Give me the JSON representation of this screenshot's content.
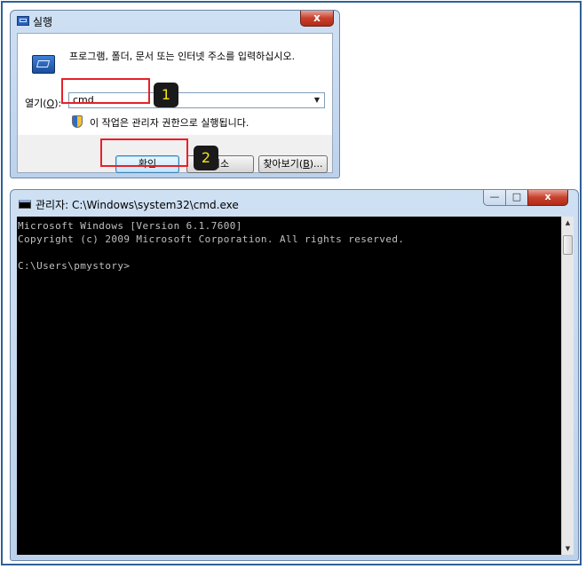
{
  "run_dialog": {
    "title": "실행",
    "close_glyph": "x",
    "description": "프로그램, 폴더, 문서 또는 인터넷 주소를 입력하십시오.",
    "open_label_prefix": "열기(",
    "open_label_key": "O",
    "open_label_suffix": "):",
    "open_value": "cmd",
    "admin_note": "이 작업은 관리자 권한으로 실행됩니다.",
    "ok_label": "확인",
    "cancel_label": "취소",
    "browse_label_prefix": "찾아보기(",
    "browse_label_key": "B",
    "browse_label_suffix": ")...",
    "icons": [
      "run-app-icon",
      "shield-icon",
      "chevron-down-icon"
    ]
  },
  "annotations": {
    "step1": "1",
    "step2": "2",
    "highlight_color": "#e8202a",
    "badge_color": "#f4e419"
  },
  "cmd_window": {
    "title": "관리자: C:\\Windows\\system32\\cmd.exe",
    "minimize_glyph": "—",
    "maximize_glyph": "□",
    "close_glyph": "x",
    "lines": [
      "Microsoft Windows [Version 6.1.7600]",
      "Copyright (c) 2009 Microsoft Corporation. All rights reserved.",
      "C:\\Users\\pmystory>"
    ],
    "background_color": "#000000",
    "text_color": "#c0c0c0"
  }
}
